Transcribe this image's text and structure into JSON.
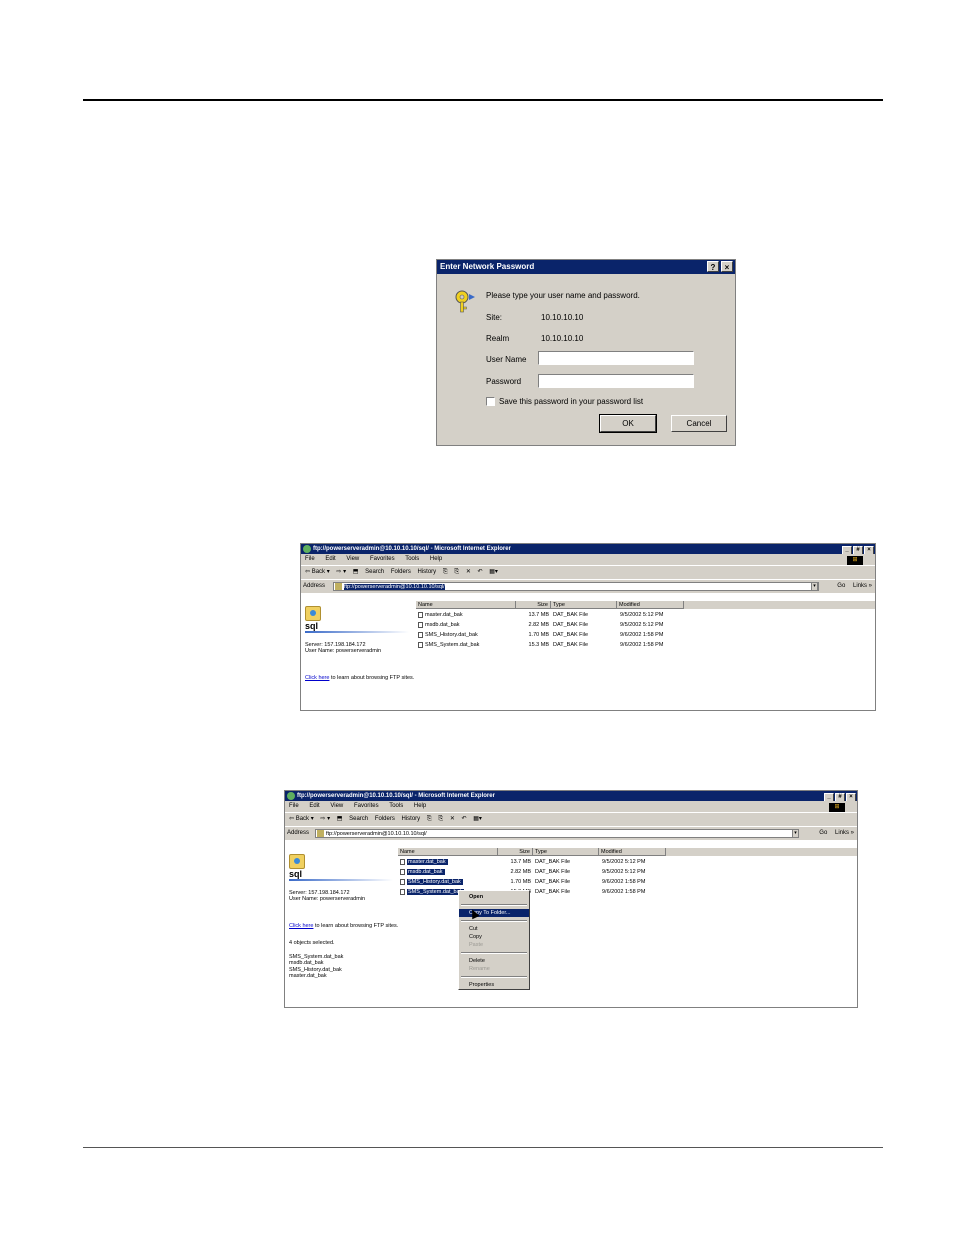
{
  "dialog": {
    "title": "Enter Network Password",
    "help_button": "?",
    "close_button": "×",
    "prompt": "Please type your user name and password.",
    "site_label": "Site:",
    "site_value": "10.10.10.10",
    "realm_label": "Realm",
    "realm_value": "10.10.10.10",
    "username_label": "User Name",
    "password_label": "Password",
    "save_password_label": "Save this password in your password list",
    "ok_label": "OK",
    "cancel_label": "Cancel"
  },
  "window1": {
    "title": "ftp://powerserveradmin@10.10.10.10/sql/ - Microsoft Internet Explorer",
    "controls": [
      "_",
      "#",
      "×"
    ],
    "menu": [
      "File",
      "Edit",
      "View",
      "Favorites",
      "Tools",
      "Help"
    ],
    "toolbar": [
      "⇦ Back ▾",
      "⇨ ▾",
      "⬒",
      "Search",
      "Folders",
      "History",
      "⎘",
      "⎘",
      "✕",
      "↶",
      "▦▾"
    ],
    "address_label": "Address",
    "address_value": "ftp://powerserveradmin@10.10.10.10/sql/",
    "go_label": "Go",
    "links_label": "Links »",
    "folder_name": "sql",
    "server_info": "Server: 157.198.184.172",
    "user_info": "User Name: powerserveradmin",
    "click_here": "Click here",
    "learn_text": " to learn about browsing FTP sites.",
    "columns": [
      "Name",
      "Size",
      "Type",
      "Modified"
    ],
    "files": [
      {
        "name": "master.dat_bak",
        "size": "13.7 MB",
        "type": "DAT_BAK File",
        "modified": "9/5/2002 5:12 PM"
      },
      {
        "name": "msdb.dat_bak",
        "size": "2.82 MB",
        "type": "DAT_BAK File",
        "modified": "9/5/2002 5:12 PM"
      },
      {
        "name": "SMS_History.dat_bak",
        "size": "1.70 MB",
        "type": "DAT_BAK File",
        "modified": "9/6/2002 1:58 PM"
      },
      {
        "name": "SMS_System.dat_bak",
        "size": "15.3 MB",
        "type": "DAT_BAK File",
        "modified": "9/6/2002 1:58 PM"
      }
    ]
  },
  "window2": {
    "title": "ftp://powerserveradmin@10.10.10.10/sql/ - Microsoft Internet Explorer",
    "controls": [
      "_",
      "#",
      "×"
    ],
    "menu": [
      "File",
      "Edit",
      "View",
      "Favorites",
      "Tools",
      "Help"
    ],
    "toolbar": [
      "⇦ Back ▾",
      "⇨ ▾",
      "⬒",
      "Search",
      "Folders",
      "History",
      "⎘",
      "⎘",
      "✕",
      "↶",
      "▦▾"
    ],
    "address_label": "Address",
    "address_value": "ftp://powerserveradmin@10.10.10.10/sql/",
    "go_label": "Go",
    "links_label": "Links »",
    "folder_name": "sql",
    "server_info": "Server: 157.198.184.172",
    "user_info": "User Name: powerserveradmin",
    "click_here": "Click here",
    "learn_text": " to learn about browsing FTP sites.",
    "selected_count": "4 objects selected.",
    "selected_list": [
      "SMS_System.dat_bak",
      "msdb.dat_bak",
      "SMS_History.dat_bak",
      "master.dat_bak"
    ],
    "columns": [
      "Name",
      "Size",
      "Type",
      "Modified"
    ],
    "files": [
      {
        "name": "master.dat_bak",
        "size": "13.7 MB",
        "type": "DAT_BAK File",
        "modified": "9/5/2002 5:12 PM"
      },
      {
        "name": "msdb.dat_bak",
        "size": "2.82 MB",
        "type": "DAT_BAK File",
        "modified": "9/5/2002 5:12 PM"
      },
      {
        "name": "SMS_History.dat_bak",
        "size": "1.70 MB",
        "type": "DAT_BAK File",
        "modified": "9/6/2002 1:58 PM"
      },
      {
        "name": "SMS_System.dat_bak",
        "size": "15.3 MB",
        "type": "DAT_BAK File",
        "modified": "9/6/2002 1:58 PM"
      }
    ],
    "context_menu": {
      "open": "Open",
      "copy_to_folder": "Copy To Folder...",
      "cut": "Cut",
      "copy": "Copy",
      "paste": "Paste",
      "delete": "Delete",
      "rename": "Rename",
      "properties": "Properties"
    }
  }
}
